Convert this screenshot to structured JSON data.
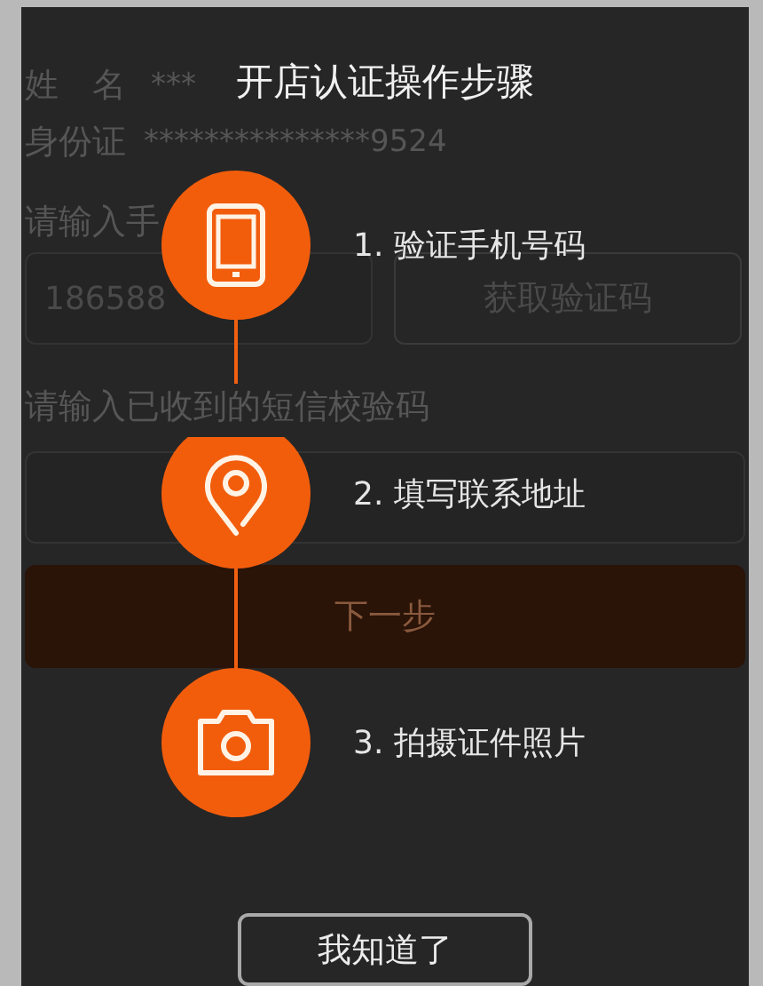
{
  "form": {
    "name_label": "姓　名",
    "name_value": "***",
    "id_label": "身份证",
    "id_value": "***************9524",
    "phone_label": "请输入手",
    "phone_value": "186588",
    "code_button": "获取验证码",
    "sms_label": "请输入已收到的短信校验码",
    "next_button": "下一步"
  },
  "guide": {
    "title": "开店认证操作步骤",
    "steps": [
      {
        "kind": "phone",
        "label": "1. 验证手机号码"
      },
      {
        "kind": "location",
        "label": "2. 填写联系地址"
      },
      {
        "kind": "camera",
        "label": "3. 拍摄证件照片"
      }
    ],
    "dismiss_button": "我知道了"
  }
}
